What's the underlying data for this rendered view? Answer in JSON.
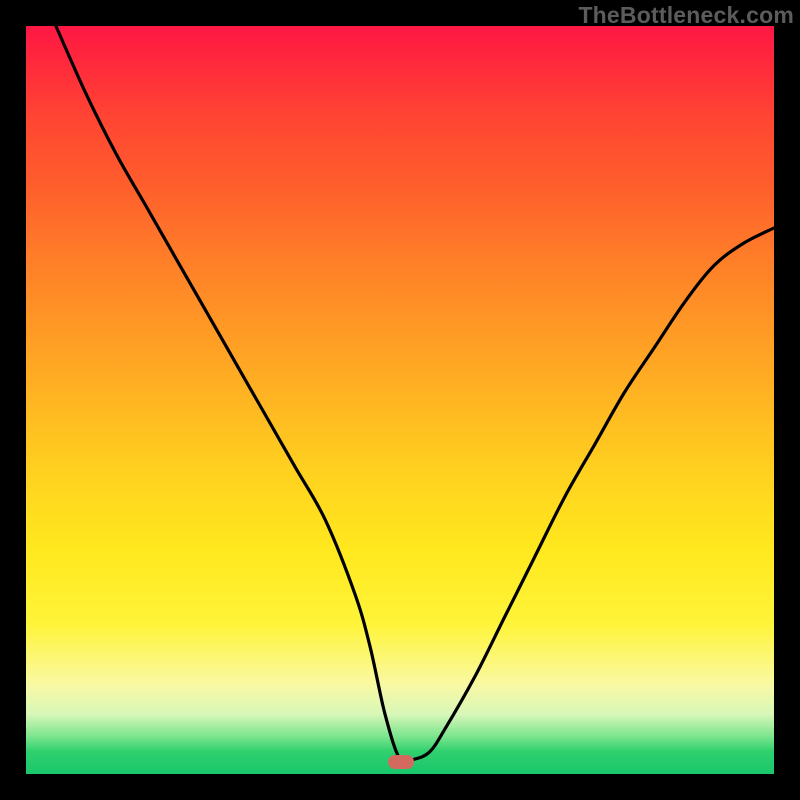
{
  "watermark": "TheBottleneck.com",
  "marker": {
    "x_frac": 0.502,
    "y_frac": 0.984,
    "color": "#d46a5f"
  },
  "chart_data": {
    "type": "line",
    "title": "",
    "xlabel": "",
    "ylabel": "",
    "xlim": [
      0,
      100
    ],
    "ylim": [
      0,
      100
    ],
    "grid": false,
    "legend": false,
    "series": [
      {
        "name": "curve",
        "x": [
          4,
          8,
          12,
          16,
          20,
          24,
          28,
          32,
          36,
          40,
          44,
          46,
          48,
          50,
          52,
          54,
          56,
          60,
          64,
          68,
          72,
          76,
          80,
          84,
          88,
          92,
          96,
          100
        ],
        "y": [
          100,
          91,
          83,
          76,
          69,
          62,
          55,
          48,
          41,
          34,
          24,
          17,
          8,
          2,
          2,
          3,
          6,
          13,
          21,
          29,
          37,
          44,
          51,
          57,
          63,
          68,
          71,
          73
        ]
      }
    ],
    "annotations": [
      {
        "type": "marker",
        "x": 50,
        "y": 2,
        "shape": "rounded-rect",
        "color": "#d46a5f"
      }
    ],
    "background_gradient": {
      "direction": "vertical",
      "stops": [
        {
          "pos": 0.0,
          "color": "#ff1744"
        },
        {
          "pos": 0.5,
          "color": "#ffb522"
        },
        {
          "pos": 0.8,
          "color": "#fff43a"
        },
        {
          "pos": 1.0,
          "color": "#19c76c"
        }
      ]
    }
  }
}
